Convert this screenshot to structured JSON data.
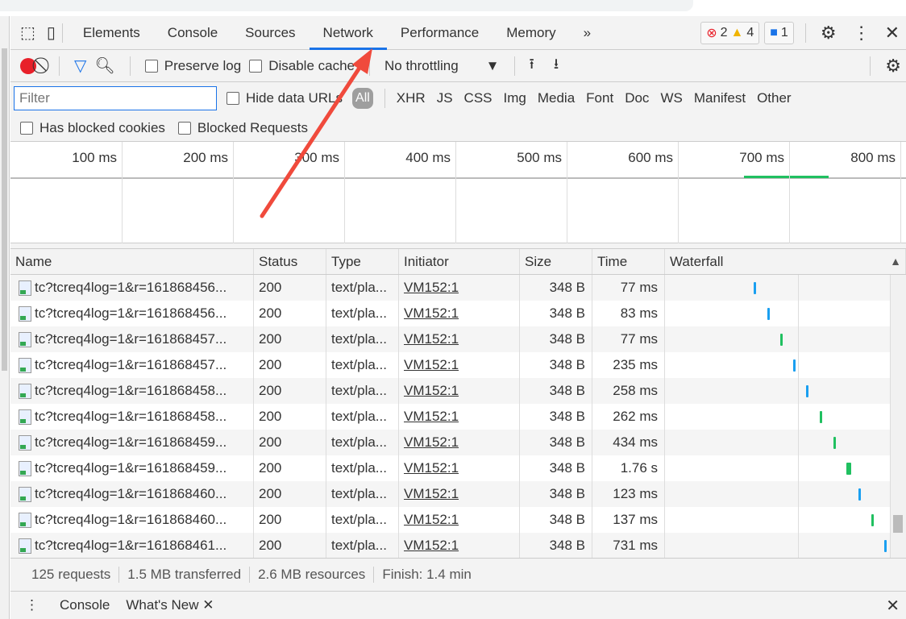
{
  "tabs": [
    {
      "label": "Elements"
    },
    {
      "label": "Console"
    },
    {
      "label": "Sources"
    },
    {
      "label": "Network",
      "active": true
    },
    {
      "label": "Performance"
    },
    {
      "label": "Memory"
    }
  ],
  "more_tabs": "»",
  "badges": {
    "errors": "2",
    "warnings": "4",
    "info": "1"
  },
  "toolbar": {
    "preserve_log": "Preserve log",
    "disable_cache": "Disable cache",
    "throttling": "No throttling"
  },
  "filter": {
    "placeholder": "Filter",
    "hide_data_urls": "Hide data URLs",
    "types": [
      "All",
      "XHR",
      "JS",
      "CSS",
      "Img",
      "Media",
      "Font",
      "Doc",
      "WS",
      "Manifest",
      "Other"
    ]
  },
  "blocked": {
    "cookies": "Has blocked cookies",
    "requests": "Blocked Requests"
  },
  "timeline": {
    "ticks": [
      "100 ms",
      "200 ms",
      "300 ms",
      "400 ms",
      "500 ms",
      "600 ms",
      "700 ms",
      "800 ms"
    ]
  },
  "columns": [
    "Name",
    "Status",
    "Type",
    "Initiator",
    "Size",
    "Time",
    "Waterfall"
  ],
  "rows": [
    {
      "name": "tc?tcreq4log=1&r=161868456...",
      "status": "200",
      "type": "text/pla...",
      "initiator": "VM152:1",
      "size": "348 B",
      "time": "77 ms"
    },
    {
      "name": "tc?tcreq4log=1&r=161868456...",
      "status": "200",
      "type": "text/pla...",
      "initiator": "VM152:1",
      "size": "348 B",
      "time": "83 ms"
    },
    {
      "name": "tc?tcreq4log=1&r=161868457...",
      "status": "200",
      "type": "text/pla...",
      "initiator": "VM152:1",
      "size": "348 B",
      "time": "77 ms"
    },
    {
      "name": "tc?tcreq4log=1&r=161868457...",
      "status": "200",
      "type": "text/pla...",
      "initiator": "VM152:1",
      "size": "348 B",
      "time": "235 ms"
    },
    {
      "name": "tc?tcreq4log=1&r=161868458...",
      "status": "200",
      "type": "text/pla...",
      "initiator": "VM152:1",
      "size": "348 B",
      "time": "258 ms"
    },
    {
      "name": "tc?tcreq4log=1&r=161868458...",
      "status": "200",
      "type": "text/pla...",
      "initiator": "VM152:1",
      "size": "348 B",
      "time": "262 ms"
    },
    {
      "name": "tc?tcreq4log=1&r=161868459...",
      "status": "200",
      "type": "text/pla...",
      "initiator": "VM152:1",
      "size": "348 B",
      "time": "434 ms"
    },
    {
      "name": "tc?tcreq4log=1&r=161868459...",
      "status": "200",
      "type": "text/pla...",
      "initiator": "VM152:1",
      "size": "348 B",
      "time": "1.76 s"
    },
    {
      "name": "tc?tcreq4log=1&r=161868460...",
      "status": "200",
      "type": "text/pla...",
      "initiator": "VM152:1",
      "size": "348 B",
      "time": "123 ms"
    },
    {
      "name": "tc?tcreq4log=1&r=161868460...",
      "status": "200",
      "type": "text/pla...",
      "initiator": "VM152:1",
      "size": "348 B",
      "time": "137 ms"
    },
    {
      "name": "tc?tcreq4log=1&r=161868461...",
      "status": "200",
      "type": "text/pla...",
      "initiator": "VM152:1",
      "size": "348 B",
      "time": "731 ms"
    }
  ],
  "status": {
    "requests": "125 requests",
    "transferred": "1.5 MB transferred",
    "resources": "2.6 MB resources",
    "finish": "Finish: 1.4 min"
  },
  "drawer": {
    "console": "Console",
    "whats_new": "What's New"
  },
  "colors": {
    "accent": "#1a73e8",
    "record": "#e8202a",
    "annotation_arrow": "#f04a3c",
    "waterfall_blue": "#1a9ff0",
    "waterfall_green": "#20c060"
  }
}
